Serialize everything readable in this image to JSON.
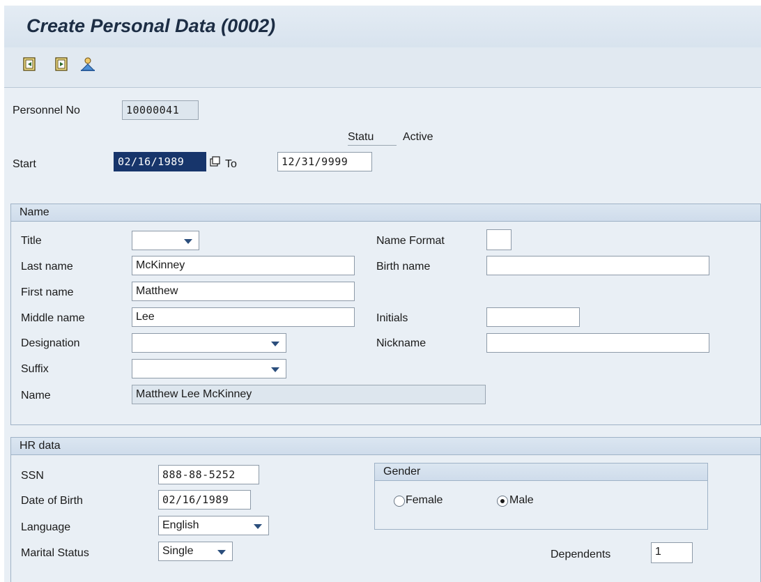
{
  "title": "Create Personal Data (0002)",
  "toolbar": {
    "icons": [
      "previous-record-icon",
      "next-record-icon",
      "person-overview-icon"
    ]
  },
  "header": {
    "personnel_no_label": "Personnel No",
    "personnel_no_value": "10000041",
    "status_label": "Statu",
    "status_value": "Active",
    "start_label": "Start",
    "start_value": "02/16/1989",
    "to_label": "To",
    "to_value": "12/31/9999"
  },
  "name_group": {
    "heading": "Name",
    "title_label": "Title",
    "title_value": "",
    "name_format_label": "Name Format",
    "name_format_value": "",
    "last_name_label": "Last name",
    "last_name_value": "McKinney",
    "birth_name_label": "Birth name",
    "birth_name_value": "",
    "first_name_label": "First name",
    "first_name_value": "Matthew",
    "middle_name_label": "Middle name",
    "middle_name_value": "Lee",
    "initials_label": "Initials",
    "initials_value": "",
    "designation_label": "Designation",
    "designation_value": "",
    "nickname_label": "Nickname",
    "nickname_value": "",
    "suffix_label": "Suffix",
    "suffix_value": "",
    "name_label": "Name",
    "name_value": "Matthew Lee McKinney"
  },
  "hr_group": {
    "heading": "HR data",
    "ssn_label": "SSN",
    "ssn_value": "888-88-5252",
    "dob_label": "Date of Birth",
    "dob_value": "02/16/1989",
    "language_label": "Language",
    "language_value": "English",
    "marital_label": "Marital Status",
    "marital_value": "Single",
    "gender_heading": "Gender",
    "female_label": "Female",
    "male_label": "Male",
    "gender_selected": "Male",
    "dependents_label": "Dependents",
    "dependents_value": "1"
  },
  "colors": {
    "title_bg": "#e4ecf4",
    "content_bg": "#e9eff5",
    "selected_field": "#17356b",
    "title_text": "#1c2d44"
  }
}
